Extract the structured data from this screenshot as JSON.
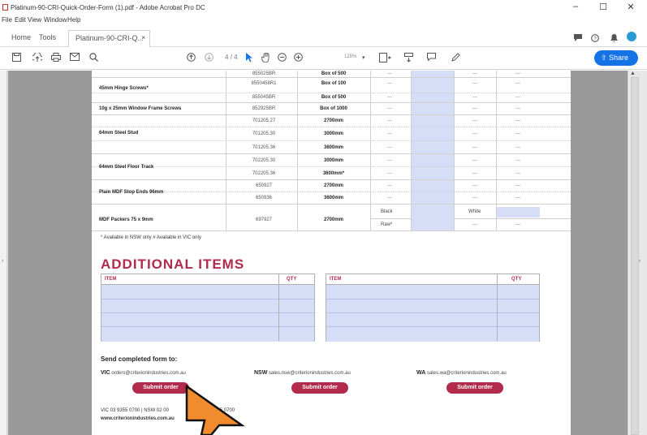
{
  "window": {
    "title": "Platinum-90-CRI-Quick-Order-Form (1).pdf - Adobe Acrobat Pro DC",
    "controls": {
      "minimize": "–",
      "maximize": "☐",
      "close": "✕"
    }
  },
  "menu": [
    "File",
    "Edit",
    "View",
    "Window",
    "Help"
  ],
  "tabs": {
    "home": "Home",
    "tools": "Tools",
    "document": "Platinum-90-CRI-Q...",
    "close": "×"
  },
  "toolbar": {
    "page_current": "4",
    "page_total": "/ 4",
    "zoom": "125%",
    "share": "Share"
  },
  "table": {
    "rows": [
      {
        "name": "",
        "code": "855025BR",
        "pack": "Box of 500"
      },
      {
        "name": "45mm Hinge Screws*",
        "code": "8550458R1",
        "pack": "Box of 100"
      },
      {
        "name": "",
        "code": "855045BR",
        "pack": "Box of 500"
      },
      {
        "name": "10g x 25mm Window Frame Screws",
        "code": "852925BR",
        "pack": "Box of 1000"
      },
      {
        "name": "64mm Steel Stud",
        "code": "701205.27",
        "pack": "2700mm"
      },
      {
        "name": "",
        "code": "701205.30",
        "pack": "3000mm"
      },
      {
        "name": "",
        "code": "701205.36",
        "pack": "3600mm"
      },
      {
        "name": "64mm Steel Floor Track",
        "code": "702205.30",
        "pack": "3000mm"
      },
      {
        "name": "",
        "code": "702205.36",
        "pack": "3600mm*"
      },
      {
        "name": "Plain MDF Stop Ends 96mm",
        "code": "650927",
        "pack": "2700mm"
      },
      {
        "name": "",
        "code": "650936",
        "pack": "3600mm"
      },
      {
        "name": "MDF Packers 75 x 9mm",
        "code": "697927",
        "pack": "2700mm"
      }
    ],
    "dash": "—",
    "black": "Black",
    "raw": "Raw*",
    "white": "White"
  },
  "note": "* Available in NSW only   # Available in VIC only",
  "additional": {
    "title": "ADDITIONAL ITEMS",
    "item_header": "ITEM",
    "qty_header": "QTY"
  },
  "send": {
    "heading": "Send completed form to:",
    "vic_label": "VIC",
    "vic_email": "orders@criterionindustries.com.au",
    "nsw_label": "NSW",
    "nsw_email": "sales.nsw@criterionindustries.com.au",
    "wa_label": "WA",
    "wa_email": "sales.wa@criterionindustries.com.au",
    "submit": "Submit order"
  },
  "footer": {
    "phones_visible": "VIC 03 9355 0700 | NSW 02 00",
    "phones_tail": "8 9355 0700",
    "website": "www.criterionindustries.com.au"
  }
}
